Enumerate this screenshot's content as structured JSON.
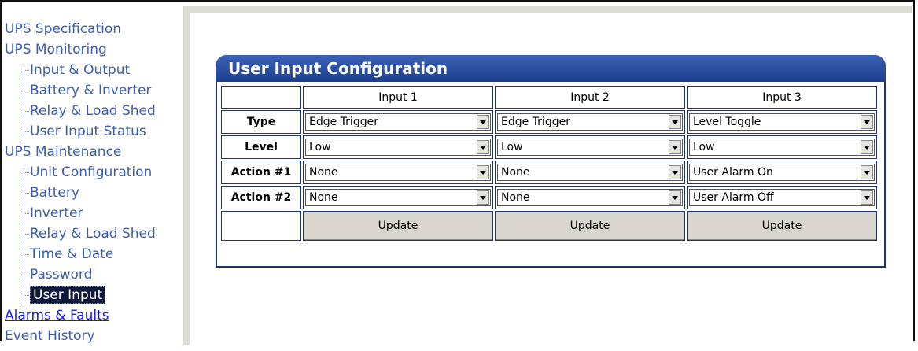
{
  "nav": {
    "items": [
      {
        "label": "UPS Specification",
        "level": 0
      },
      {
        "label": "UPS Monitoring",
        "level": 0
      },
      {
        "label": "Input & Output",
        "level": 1
      },
      {
        "label": "Battery & Inverter",
        "level": 1
      },
      {
        "label": "Relay & Load Shed",
        "level": 1
      },
      {
        "label": "User Input Status",
        "level": 1
      },
      {
        "label": "UPS Maintenance",
        "level": 0
      },
      {
        "label": "Unit Configuration",
        "level": 1
      },
      {
        "label": "Battery",
        "level": 1
      },
      {
        "label": "Inverter",
        "level": 1
      },
      {
        "label": "Relay & Load Shed",
        "level": 1
      },
      {
        "label": "Time & Date",
        "level": 1
      },
      {
        "label": "Password",
        "level": 1
      },
      {
        "label": "User Input",
        "level": 1,
        "active": true
      },
      {
        "label": "Alarms & Faults",
        "level": 0,
        "link": true
      },
      {
        "label": "Event History",
        "level": 0
      }
    ]
  },
  "panel": {
    "title": "User Input Configuration",
    "columns": [
      "Input 1",
      "Input 2",
      "Input 3"
    ],
    "rows": [
      {
        "label": "Type",
        "values": [
          "Edge Trigger",
          "Edge Trigger",
          "Level Toggle"
        ]
      },
      {
        "label": "Level",
        "values": [
          "Low",
          "Low",
          "Low"
        ]
      },
      {
        "label": "Action #1",
        "values": [
          "None",
          "None",
          "User Alarm On"
        ]
      },
      {
        "label": "Action #2",
        "values": [
          "None",
          "None",
          "User Alarm Off"
        ]
      }
    ],
    "update_label": "Update"
  },
  "colors": {
    "header_blue": "#1d3f8e",
    "nav_text": "#3a5db0",
    "link": "#1a1aee",
    "active_bg": "#0f1a3a"
  }
}
